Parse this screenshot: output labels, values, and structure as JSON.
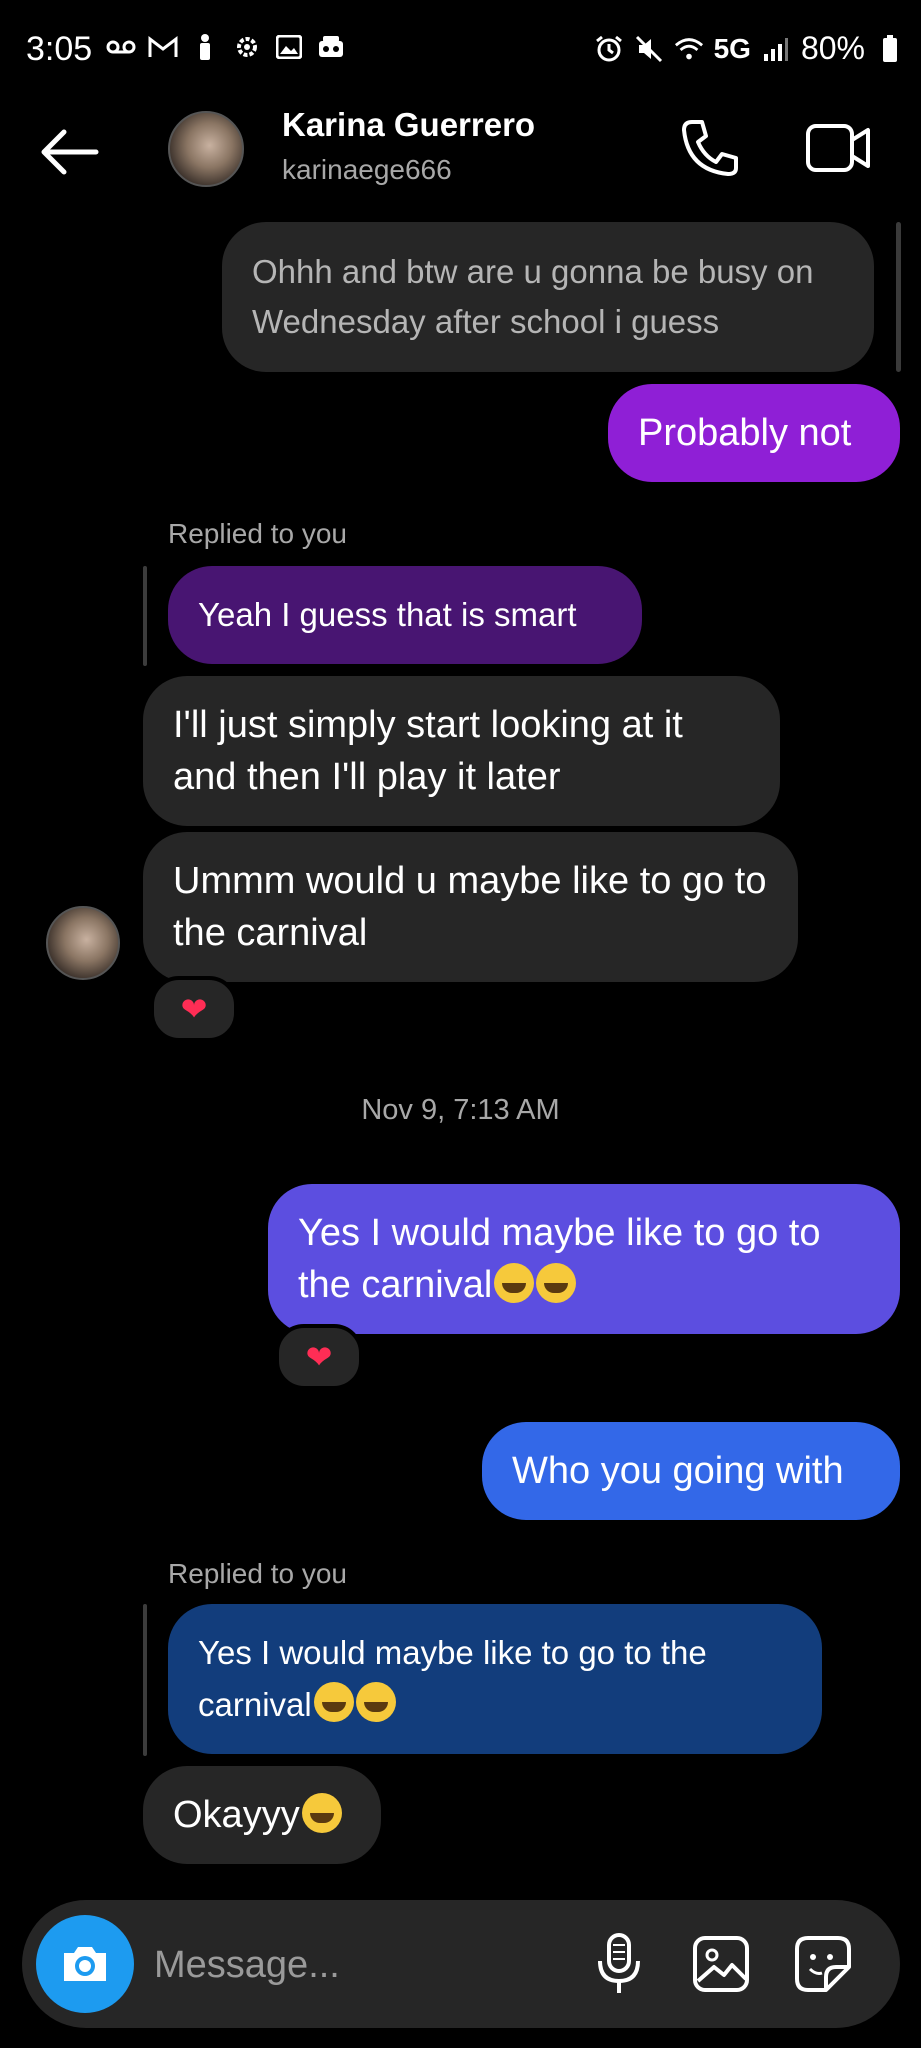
{
  "status_bar": {
    "time": "3:05",
    "network": "5G",
    "battery": "80%"
  },
  "header": {
    "name": "Karina Guerrero",
    "username": "karinaege666"
  },
  "messages": {
    "m1": {
      "text": "Ohhh and btw are u gonna be busy on Wednesday after school i guess"
    },
    "m2": {
      "text": "Probably not"
    },
    "reply1": {
      "label": "Replied to you",
      "quote": "Yeah I guess that is smart"
    },
    "m3": {
      "text": "I'll just simply start looking at it and then I'll play it later"
    },
    "m4": {
      "text": "Ummm would u maybe like to go to the carnival",
      "reaction": "❤"
    },
    "timestamp": "Nov 9, 7:13 AM",
    "m5": {
      "text": "Yes I would maybe like to go to the carnival",
      "reaction": "❤"
    },
    "m6": {
      "text": "Who you going with"
    },
    "reply2": {
      "label": "Replied to you",
      "quote": "Yes I would maybe like to go to the carnival"
    },
    "m7": {
      "text": "Okayyy"
    }
  },
  "composer": {
    "placeholder": "Message..."
  },
  "colors": {
    "camera_button": "#1d9bf0",
    "bubble_purple": "#8f1fd6",
    "bubble_indigo": "#5c4ee0",
    "bubble_blue": "#3368e8",
    "reaction_heart": "#ff2d55"
  }
}
